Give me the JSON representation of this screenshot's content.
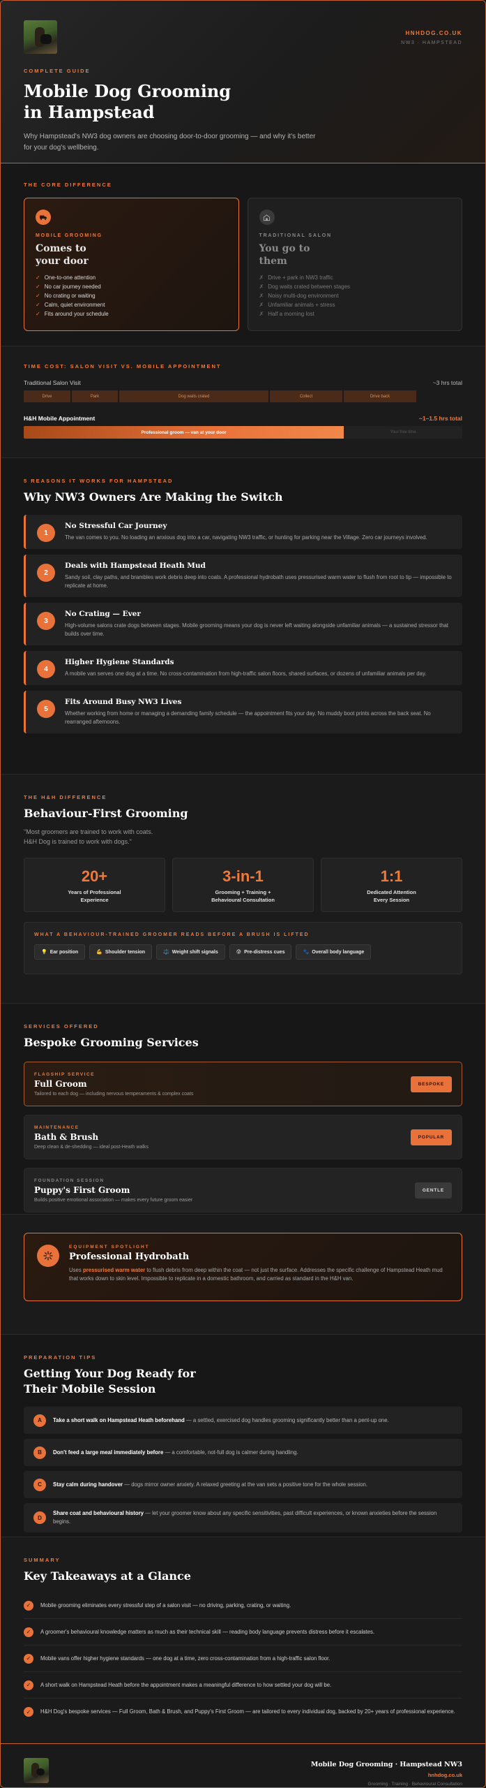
{
  "header": {
    "domain": "HNHDOG.CO.UK",
    "location": "NW3 · HAMPSTEAD",
    "eyebrow": "COMPLETE GUIDE",
    "title": "Mobile Dog Grooming in Hampstead",
    "lede": "Why Hampstead's NW3 dog owners are choosing door-to-door grooming — and why it's better for your dog's wellbeing."
  },
  "core": {
    "eyebrow": "THE CORE DIFFERENCE",
    "mobile": {
      "kicker": "MOBILE GROOMING",
      "title": "Comes to your door",
      "items": [
        "One-to-one attention",
        "No car journey needed",
        "No crating or waiting",
        "Calm, quiet environment",
        "Fits around your schedule"
      ]
    },
    "salon": {
      "kicker": "TRADITIONAL SALON",
      "title": "You go to them",
      "items": [
        "Drive + park in NW3 traffic",
        "Dog waits crated between stages",
        "Noisy multi-dog environment",
        "Unfamiliar animals + stress",
        "Half a morning lost"
      ]
    }
  },
  "timecost": {
    "eyebrow": "TIME COST: SALON VISIT VS. MOBILE APPOINTMENT",
    "salon_label": "Traditional Salon Visit",
    "salon_total": "~3 hrs total",
    "salon_segments": [
      "Drive",
      "Park",
      "Dog waits crated",
      "Collect",
      "Drive back"
    ],
    "mobile_label": "H&H Mobile Appointment",
    "mobile_total": "~1–1.5 hrs total",
    "mobile_fill_label": "Professional groom — van at your door",
    "mobile_fill_fraction": 0.73,
    "mobile_rest_label": "Your free time"
  },
  "reasons": {
    "eyebrow": "5 REASONS IT WORKS FOR HAMPSTEAD",
    "title": "Why NW3 Owners Are Making the Switch",
    "items": [
      {
        "num": "1",
        "title": "No Stressful Car Journey",
        "desc": "The van comes to you. No loading an anxious dog into a car, navigating NW3 traffic, or hunting for parking near the Village. Zero car journeys involved."
      },
      {
        "num": "2",
        "title": "Deals with Hampstead Heath Mud",
        "desc": "Sandy soil, clay paths, and brambles work debris deep into coats. A professional hydrobath uses pressurised warm water to flush from root to tip — impossible to replicate at home."
      },
      {
        "num": "3",
        "title": "No Crating — Ever",
        "desc": "High-volume salons crate dogs between stages. Mobile grooming means your dog is never left waiting alongside unfamiliar animals — a sustained stressor that builds over time."
      },
      {
        "num": "4",
        "title": "Higher Hygiene Standards",
        "desc": "A mobile van serves one dog at a time. No cross-contamination from high-traffic salon floors, shared surfaces, or dozens of unfamiliar animals per day."
      },
      {
        "num": "5",
        "title": "Fits Around Busy NW3 Lives",
        "desc": "Whether working from home or managing a demanding family schedule — the appointment fits your day. No muddy boot prints across the back seat. No rearranged afternoons."
      }
    ]
  },
  "behaviour": {
    "eyebrow": "THE H&H DIFFERENCE",
    "title": "Behaviour-First Grooming",
    "quote_1": "\"Most groomers are trained to work with coats.",
    "quote_2": "H&H Dog is trained to work with dogs.\"",
    "stats": [
      {
        "num": "20+",
        "label_1": "Years of Professional",
        "label_2": "Experience"
      },
      {
        "num": "3-in-1",
        "label_1": "Grooming + Training +",
        "label_2": "Behavioural Consultation"
      },
      {
        "num": "1:1",
        "label_1": "Dedicated Attention",
        "label_2": "Every Session"
      }
    ],
    "cues_eyebrow": "WHAT A BEHAVIOUR-TRAINED GROOMER READS BEFORE A BRUSH IS LIFTED",
    "cues": [
      {
        "icon": "💡",
        "label": "Ear position"
      },
      {
        "icon": "💪",
        "label": "Shoulder tension"
      },
      {
        "icon": "⚖️",
        "label": "Weight shift signals"
      },
      {
        "icon": "😰",
        "label": "Pre-distress cues"
      },
      {
        "icon": "🐾",
        "label": "Overall body language"
      }
    ]
  },
  "services": {
    "eyebrow": "SERVICES OFFERED",
    "title": "Bespoke Grooming Services",
    "items": [
      {
        "kicker": "FLAGSHIP SERVICE",
        "name": "Full Groom",
        "desc": "Tailored to each dog — including nervous temperaments & complex coats",
        "badge": "BESPOKE"
      },
      {
        "kicker": "MAINTENANCE",
        "name": "Bath & Brush",
        "desc": "Deep clean & de-shedding — ideal post-Heath walks",
        "badge": "POPULAR"
      },
      {
        "kicker": "FOUNDATION SESSION",
        "name": "Puppy's First Groom",
        "desc": "Builds positive emotional association — makes every future groom easier",
        "badge": "GENTLE"
      }
    ]
  },
  "equipment": {
    "eyebrow": "EQUIPMENT SPOTLIGHT",
    "title": "Professional Hydrobath",
    "desc_pre": "Uses ",
    "desc_highlight": "pressurised warm water",
    "desc_post": " to flush debris from deep within the coat — not just the surface. Addresses the specific challenge of Hampstead Heath mud that works down to skin level. Impossible to replicate in a domestic bathroom, and carried as standard in the H&H van."
  },
  "prep": {
    "eyebrow": "PREPARATION TIPS",
    "title": "Getting Your Dog Ready for Their Mobile Session",
    "tips": [
      {
        "letter": "A",
        "bold": "Take a short walk on Hampstead Heath beforehand",
        "rest": " — a settled, exercised dog handles grooming significantly better than a pent-up one."
      },
      {
        "letter": "B",
        "bold": "Don't feed a large meal immediately before",
        "rest": " — a comfortable, not-full dog is calmer during handling."
      },
      {
        "letter": "C",
        "bold": "Stay calm during handover",
        "rest": " — dogs mirror owner anxiety. A relaxed greeting at the van sets a positive tone for the whole session."
      },
      {
        "letter": "D",
        "bold": "Share coat and behavioural history",
        "rest": " — let your groomer know about any specific sensitivities, past difficult experiences, or known anxieties before the session begins."
      }
    ]
  },
  "summary": {
    "eyebrow": "SUMMARY",
    "title": "Key Takeaways at a Glance",
    "items": [
      "Mobile grooming eliminates every stressful step of a salon visit — no driving, parking, crating, or waiting.",
      "A groomer's behavioural knowledge matters as much as their technical skill — reading body language prevents distress before it escalates.",
      "Mobile vans offer higher hygiene standards — one dog at a time, zero cross-contamination from a high-traffic salon floor.",
      "A short walk on Hampstead Heath before the appointment makes a meaningful difference to how settled your dog will be.",
      "H&H Dog's bespoke services — Full Groom, Bath & Brush, and Puppy's First Groom — are tailored to every individual dog, backed by 20+ years of professional experience."
    ]
  },
  "footer": {
    "title": "Mobile Dog Grooming · Hampstead NW3",
    "url": "hnhdog.co.uk",
    "tagline": "Grooming · Training · Behavioural Consultation"
  },
  "colors": {
    "accent": "#e8723a",
    "background": "#171717",
    "card": "#222222"
  }
}
